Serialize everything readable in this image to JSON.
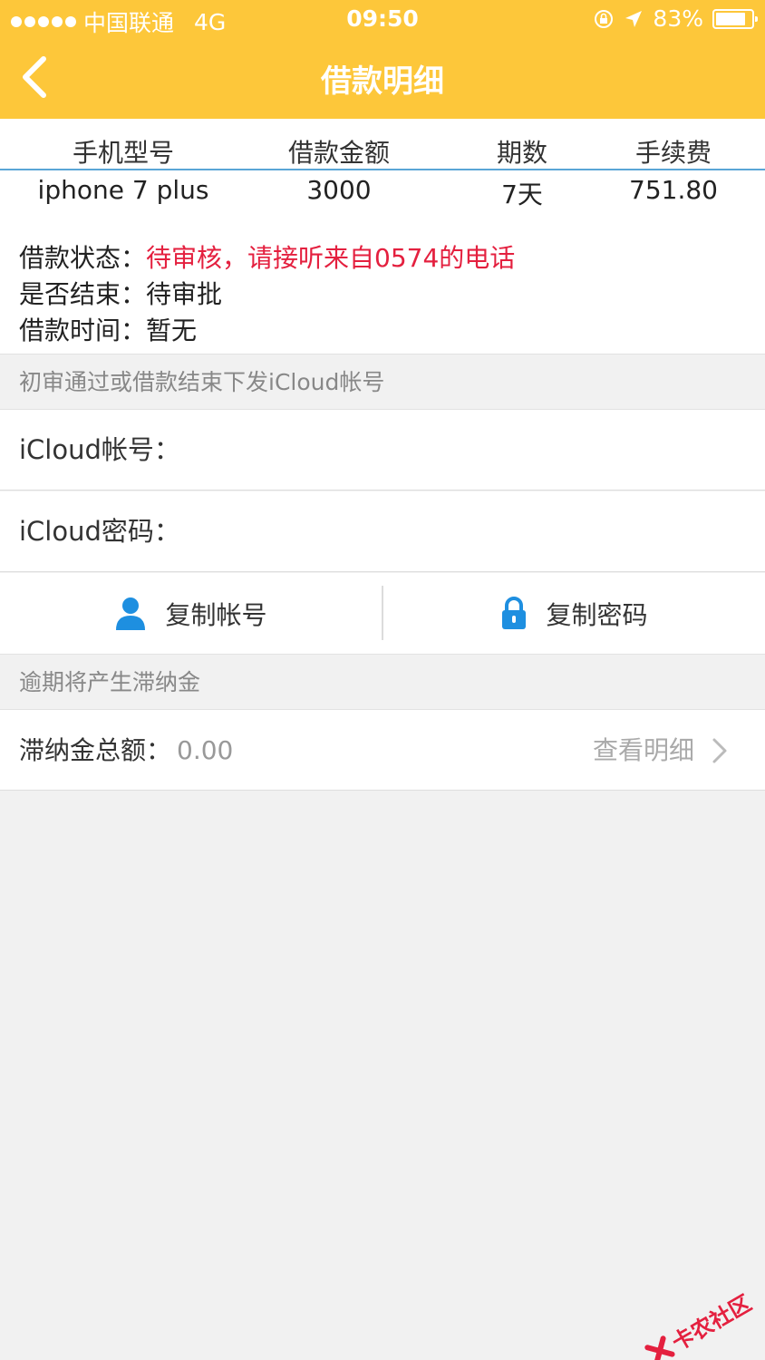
{
  "status_bar": {
    "carrier": "中国联通",
    "network": "4G",
    "time": "09:50",
    "battery": "83%",
    "battery_level": 0.83
  },
  "header": {
    "title": "借款明细",
    "back_icon": "chevron-left-icon"
  },
  "summary": {
    "columns": [
      "手机型号",
      "借款金额",
      "期数",
      "手续费"
    ],
    "values": [
      "iphone 7 plus",
      "3000",
      "7天",
      "751.80"
    ]
  },
  "loan_info": {
    "status_label": "借款状态：",
    "status_value": "待审核，请接听来自0574的电话",
    "finished_label": "是否结束：",
    "finished_value": "待审批",
    "time_label": "借款时间：",
    "time_value": "暂无"
  },
  "icloud": {
    "hint": "初审通过或借款结束下发iCloud帐号",
    "account_label": "iCloud帐号：",
    "password_label": "iCloud密码：",
    "copy_account": "复制帐号",
    "copy_password": "复制密码",
    "account_icon": "user-icon",
    "password_icon": "lock-icon"
  },
  "late_fee": {
    "hint": "逾期将产生滞纳金",
    "label": "滞纳金总额：",
    "value": "0.00",
    "link": "查看明细"
  },
  "watermark": {
    "text": "卡农社区"
  },
  "colors": {
    "header": "#fdc73a",
    "status_red": "#e4203f",
    "icon_blue": "#1e8fe0"
  }
}
